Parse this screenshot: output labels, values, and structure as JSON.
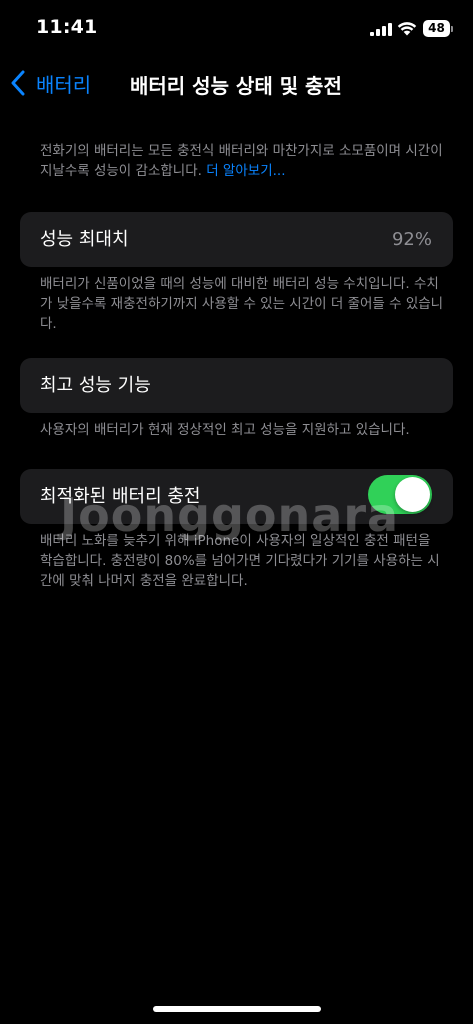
{
  "status_bar": {
    "time": "11:41",
    "battery_level": "48",
    "icons": [
      "signal-icon",
      "wifi-icon",
      "battery-icon"
    ]
  },
  "nav": {
    "back_label": "배터리",
    "title": "배터리 성능 상태 및 충전",
    "back_icon": "chevron-left-icon"
  },
  "intro": {
    "text": "전화기의 배터리는 모든 충전식 배터리와 마찬가지로 소모품이며 시간이 지날수록 성능이 감소합니다.",
    "link": "더 알아보기..."
  },
  "max_capacity": {
    "label": "성능 최대치",
    "value": "92%",
    "footer": "배터리가 신품이었을 때의 성능에 대비한 배터리 성능 수치입니다. 수치가 낮을수록 재충전하기까지 사용할 수 있는 시간이 더 줄어들 수 있습니다."
  },
  "peak_performance": {
    "label": "최고 성능 기능",
    "footer": "사용자의 배터리가 현재 정상적인 최고 성능을 지원하고 있습니다."
  },
  "optimized_charging": {
    "label": "최적화된 배터리 충전",
    "enabled": true,
    "footer": "배터리 노화를 늦추기 위해 iPhone이 사용자의 일상적인 충전 패턴을 학습합니다. 충전량이 80%를 넘어가면 기다렸다가 기기를 사용하는 시간에 맞춰 나머지 충전을 완료합니다."
  },
  "watermark": "Joonggonara",
  "colors": {
    "accent": "#0a84ff",
    "toggle_on": "#30d158",
    "group_bg": "#1c1c1e",
    "secondary_text": "#8e8e93"
  }
}
